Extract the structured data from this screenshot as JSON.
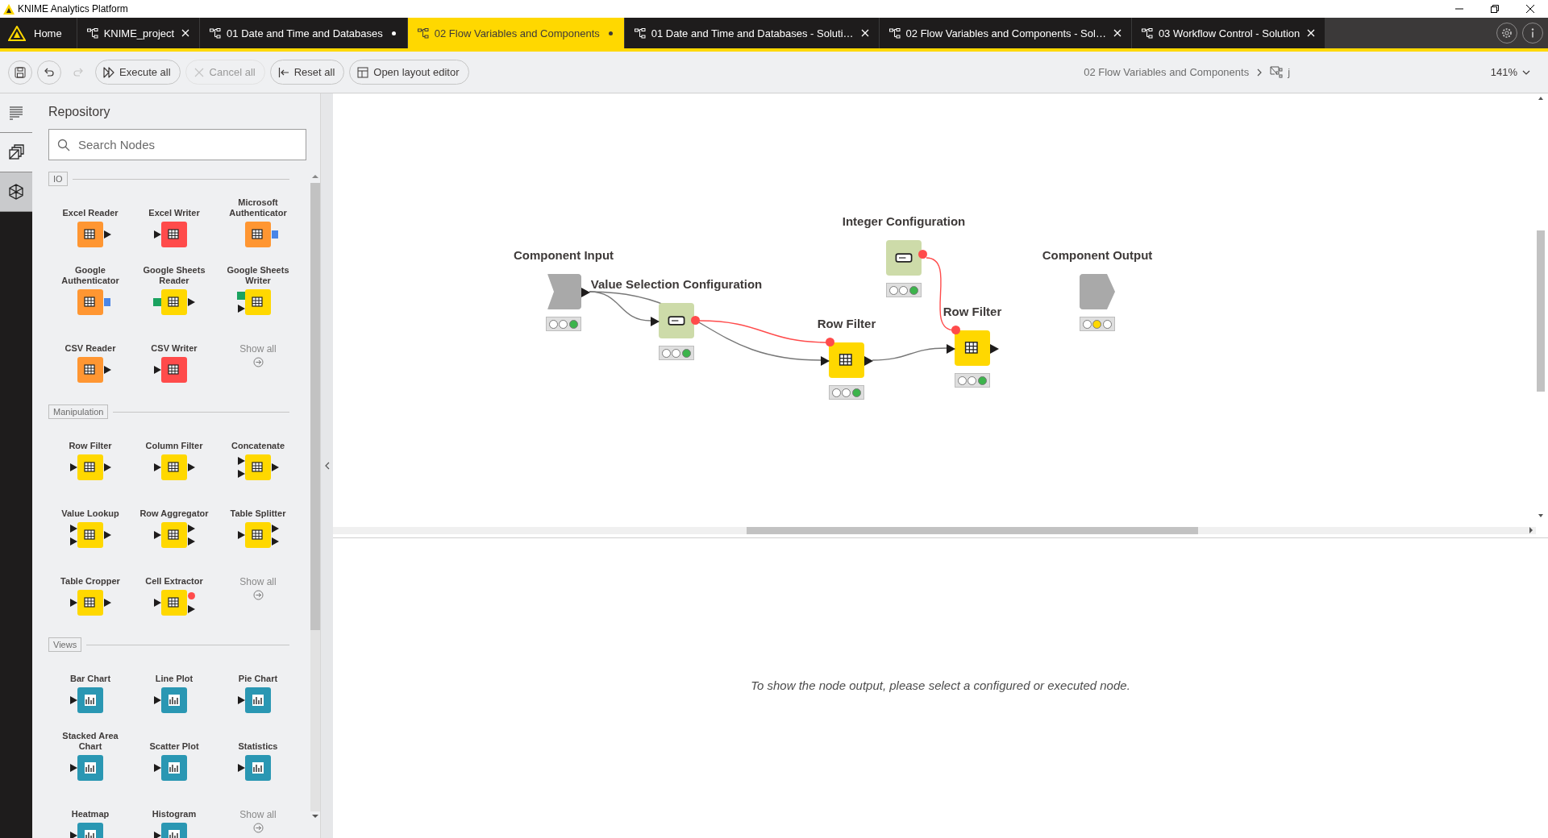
{
  "window": {
    "title": "KNIME Analytics Platform"
  },
  "tabs": [
    {
      "label": "Home",
      "kind": "home",
      "selected": false
    },
    {
      "label": "KNIME_project",
      "kind": "workflow",
      "selected": false,
      "unsaved": false
    },
    {
      "label": "01 Date and Time and Databases",
      "kind": "workflow",
      "selected": false,
      "unsaved": true
    },
    {
      "label": "02 Flow Variables and Components",
      "kind": "workflow",
      "selected": true,
      "unsaved": true
    },
    {
      "label": "01 Date and Time and Databases - Soluti…",
      "kind": "workflow",
      "selected": false,
      "unsaved": false
    },
    {
      "label": "02 Flow Variables and Components - Sol…",
      "kind": "workflow",
      "selected": false,
      "unsaved": false
    },
    {
      "label": "03 Workflow Control - Solution",
      "kind": "workflow",
      "selected": false,
      "unsaved": false
    }
  ],
  "toolbar": {
    "icon_buttons": [
      {
        "kind": "save",
        "disabled": false
      },
      {
        "kind": "undo",
        "disabled": false
      },
      {
        "kind": "redo",
        "disabled": true
      }
    ],
    "buttons": [
      {
        "label": "Execute all",
        "kind": "execute",
        "disabled": false
      },
      {
        "label": "Cancel all",
        "kind": "cancel",
        "disabled": true
      },
      {
        "label": "Reset all",
        "kind": "reset",
        "disabled": false
      },
      {
        "label": "Open layout editor",
        "kind": "layout",
        "disabled": false
      }
    ],
    "breadcrumb": [
      {
        "label": "02 Flow Variables and Components",
        "kind": "workflow"
      },
      {
        "label": "j",
        "kind": "component"
      }
    ],
    "zoom": "141%"
  },
  "sidebar": {
    "items": [
      {
        "kind": "description",
        "selected": false
      },
      {
        "kind": "spaces",
        "selected": false
      },
      {
        "kind": "repository",
        "selected": true
      }
    ]
  },
  "repository": {
    "title": "Repository",
    "search": {
      "placeholder": "Search Nodes"
    },
    "categories": [
      {
        "name": "IO",
        "show_all": "Show all",
        "nodes": [
          {
            "name": "Excel Reader",
            "kind": "source",
            "out_ports": [
              {
                "kind": "table"
              }
            ]
          },
          {
            "name": "Excel Writer",
            "kind": "sink",
            "in_ports": [
              {
                "kind": "table"
              }
            ]
          },
          {
            "name": "Microsoft Authenticator",
            "kind": "source",
            "out_ports": [
              {
                "kind": "credential"
              }
            ]
          },
          {
            "name": "Google Authenticator",
            "kind": "source",
            "out_ports": [
              {
                "kind": "credential"
              }
            ]
          },
          {
            "name": "Google Sheets Reader",
            "kind": "manipulator",
            "in_ports": [
              {
                "kind": "connection"
              }
            ],
            "out_ports": [
              {
                "kind": "table"
              }
            ]
          },
          {
            "name": "Google Sheets Writer",
            "kind": "manipulator",
            "in_ports": [
              {
                "kind": "connection"
              },
              {
                "kind": "table"
              }
            ]
          },
          {
            "name": "CSV Reader",
            "kind": "source",
            "out_ports": [
              {
                "kind": "table"
              }
            ]
          },
          {
            "name": "CSV Writer",
            "kind": "sink",
            "in_ports": [
              {
                "kind": "table"
              }
            ]
          }
        ]
      },
      {
        "name": "Manipulation",
        "show_all": "Show all",
        "nodes": [
          {
            "name": "Row Filter",
            "kind": "manipulator",
            "in_ports": [
              {
                "kind": "table"
              }
            ],
            "out_ports": [
              {
                "kind": "table"
              }
            ]
          },
          {
            "name": "Column Filter",
            "kind": "manipulator",
            "in_ports": [
              {
                "kind": "table"
              }
            ],
            "out_ports": [
              {
                "kind": "table"
              }
            ]
          },
          {
            "name": "Concatenate",
            "kind": "manipulator",
            "in_ports": [
              {
                "kind": "table"
              },
              {
                "kind": "table"
              }
            ],
            "out_ports": [
              {
                "kind": "table"
              }
            ]
          },
          {
            "name": "Value Lookup",
            "kind": "manipulator",
            "in_ports": [
              {
                "kind": "table"
              },
              {
                "kind": "table"
              }
            ],
            "out_ports": [
              {
                "kind": "table"
              }
            ]
          },
          {
            "name": "Row Aggregator",
            "kind": "manipulator",
            "in_ports": [
              {
                "kind": "table"
              }
            ],
            "out_ports": [
              {
                "kind": "table"
              },
              {
                "kind": "table"
              }
            ]
          },
          {
            "name": "Table Splitter",
            "kind": "manipulator",
            "in_ports": [
              {
                "kind": "table"
              }
            ],
            "out_ports": [
              {
                "kind": "table"
              },
              {
                "kind": "table"
              }
            ]
          },
          {
            "name": "Table Cropper",
            "kind": "manipulator",
            "in_ports": [
              {
                "kind": "table"
              }
            ],
            "out_ports": [
              {
                "kind": "table"
              }
            ]
          },
          {
            "name": "Cell Extractor",
            "kind": "manipulator",
            "in_ports": [
              {
                "kind": "table"
              }
            ],
            "out_ports": [
              {
                "kind": "flow"
              },
              {
                "kind": "table"
              }
            ]
          }
        ]
      },
      {
        "name": "Views",
        "show_all": "Show all",
        "nodes": [
          {
            "name": "Bar Chart",
            "kind": "view",
            "in_ports": [
              {
                "kind": "table"
              }
            ]
          },
          {
            "name": "Line Plot",
            "kind": "view",
            "in_ports": [
              {
                "kind": "table"
              }
            ]
          },
          {
            "name": "Pie Chart",
            "kind": "view",
            "in_ports": [
              {
                "kind": "table"
              }
            ]
          },
          {
            "name": "Stacked Area Chart",
            "kind": "view",
            "in_ports": [
              {
                "kind": "table"
              }
            ]
          },
          {
            "name": "Scatter Plot",
            "kind": "view",
            "in_ports": [
              {
                "kind": "table"
              }
            ]
          },
          {
            "name": "Statistics",
            "kind": "view",
            "in_ports": [
              {
                "kind": "table"
              }
            ]
          },
          {
            "name": "Heatmap",
            "kind": "view",
            "in_ports": [
              {
                "kind": "table"
              }
            ]
          },
          {
            "name": "Histogram",
            "kind": "view",
            "in_ports": [
              {
                "kind": "table"
              }
            ]
          }
        ]
      }
    ]
  },
  "canvas": {
    "nodes": [
      {
        "name": "Component Input",
        "kind": "component_input",
        "status": {
          "kind": "executed"
        },
        "out_ports": [
          {
            "kind": "table"
          }
        ]
      },
      {
        "name": "Value Selection Configuration",
        "kind": "configuration",
        "status": {
          "kind": "executed"
        },
        "in_ports": [
          {
            "kind": "table"
          }
        ],
        "out_ports": [
          {
            "kind": "flow"
          }
        ]
      },
      {
        "name": "Row Filter",
        "kind": "manipulator",
        "status": {
          "kind": "executed"
        },
        "in_ports": [
          {
            "kind": "flow"
          },
          {
            "kind": "table"
          }
        ],
        "out_ports": [
          {
            "kind": "table"
          }
        ]
      },
      {
        "name": "Integer Configuration",
        "kind": "configuration",
        "status": {
          "kind": "executed"
        },
        "out_ports": [
          {
            "kind": "flow"
          }
        ]
      },
      {
        "name": "Row Filter",
        "kind": "manipulator",
        "status": {
          "kind": "executed"
        },
        "in_ports": [
          {
            "kind": "flow"
          },
          {
            "kind": "table"
          }
        ],
        "out_ports": [
          {
            "kind": "table"
          }
        ]
      },
      {
        "name": "Component Output",
        "kind": "component_output",
        "status": {
          "kind": "configured"
        }
      }
    ],
    "connections": [
      {
        "kind": "data"
      },
      {
        "kind": "data"
      },
      {
        "kind": "flow"
      },
      {
        "kind": "data"
      },
      {
        "kind": "flow"
      }
    ]
  },
  "output": {
    "message": "To show the node output, please select a configured or executed node."
  }
}
